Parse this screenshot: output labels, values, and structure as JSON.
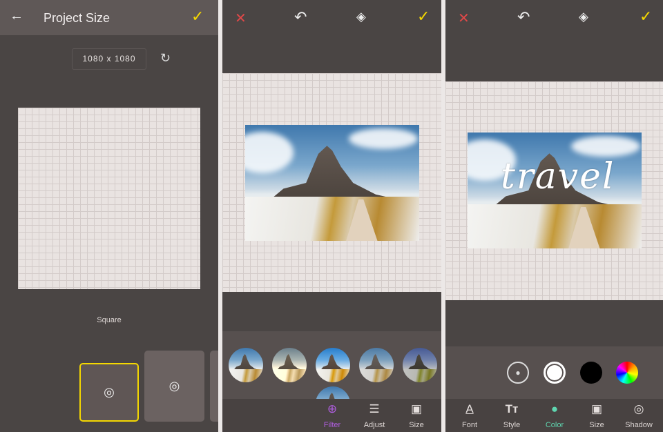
{
  "panel1": {
    "title": "Project Size",
    "size_value": "1080 x 1080",
    "preset_label": "Square",
    "accent": "#f5d800"
  },
  "panel2": {
    "tools": [
      {
        "label": "Filter",
        "icon": "filter-icon"
      },
      {
        "label": "Adjust",
        "icon": "sliders-icon"
      },
      {
        "label": "Size",
        "icon": "size-icon"
      }
    ],
    "active_color": "#b05ee0"
  },
  "panel3": {
    "overlay_text": "travel",
    "tools": [
      {
        "label": "Font",
        "icon": "font-icon"
      },
      {
        "label": "Style",
        "icon": "text-style-icon"
      },
      {
        "label": "Color",
        "icon": "palette-icon"
      },
      {
        "label": "Size",
        "icon": "size-icon"
      },
      {
        "label": "Shadow",
        "icon": "shadow-icon"
      }
    ],
    "active_color": "#5fd6b0",
    "swatches": [
      "transparent",
      "#ffffff",
      "#000000",
      "rainbow"
    ]
  }
}
